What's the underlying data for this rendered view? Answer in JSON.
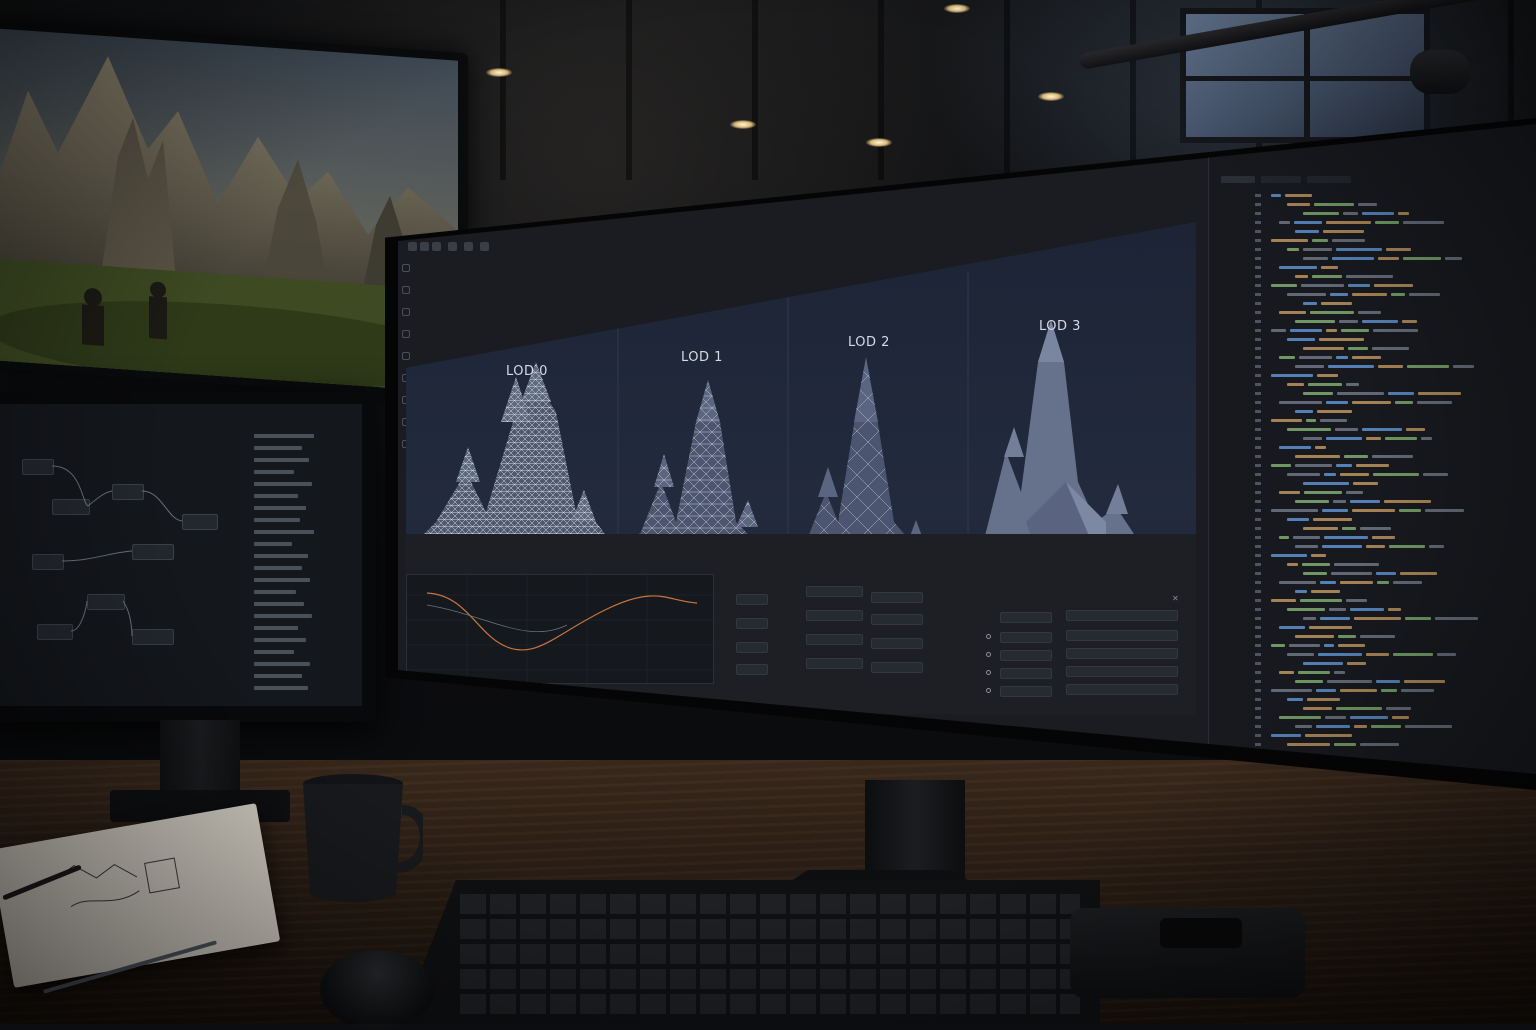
{
  "viewport": {
    "lod_labels": [
      "LOD 0",
      "LOD 1",
      "LOD 2",
      "LOD 3"
    ]
  },
  "colors": {
    "wireframe": "#c8ccd6",
    "viewport_bg": "#1f2739",
    "curve": "#c8743f",
    "code_keyword": "#6aa3e8",
    "code_string": "#d6a56a",
    "code_ident": "#8ec07c"
  },
  "icons": [
    "lod-wireframe-icon",
    "graph-node-icon",
    "chevron-right-icon",
    "close-icon"
  ]
}
